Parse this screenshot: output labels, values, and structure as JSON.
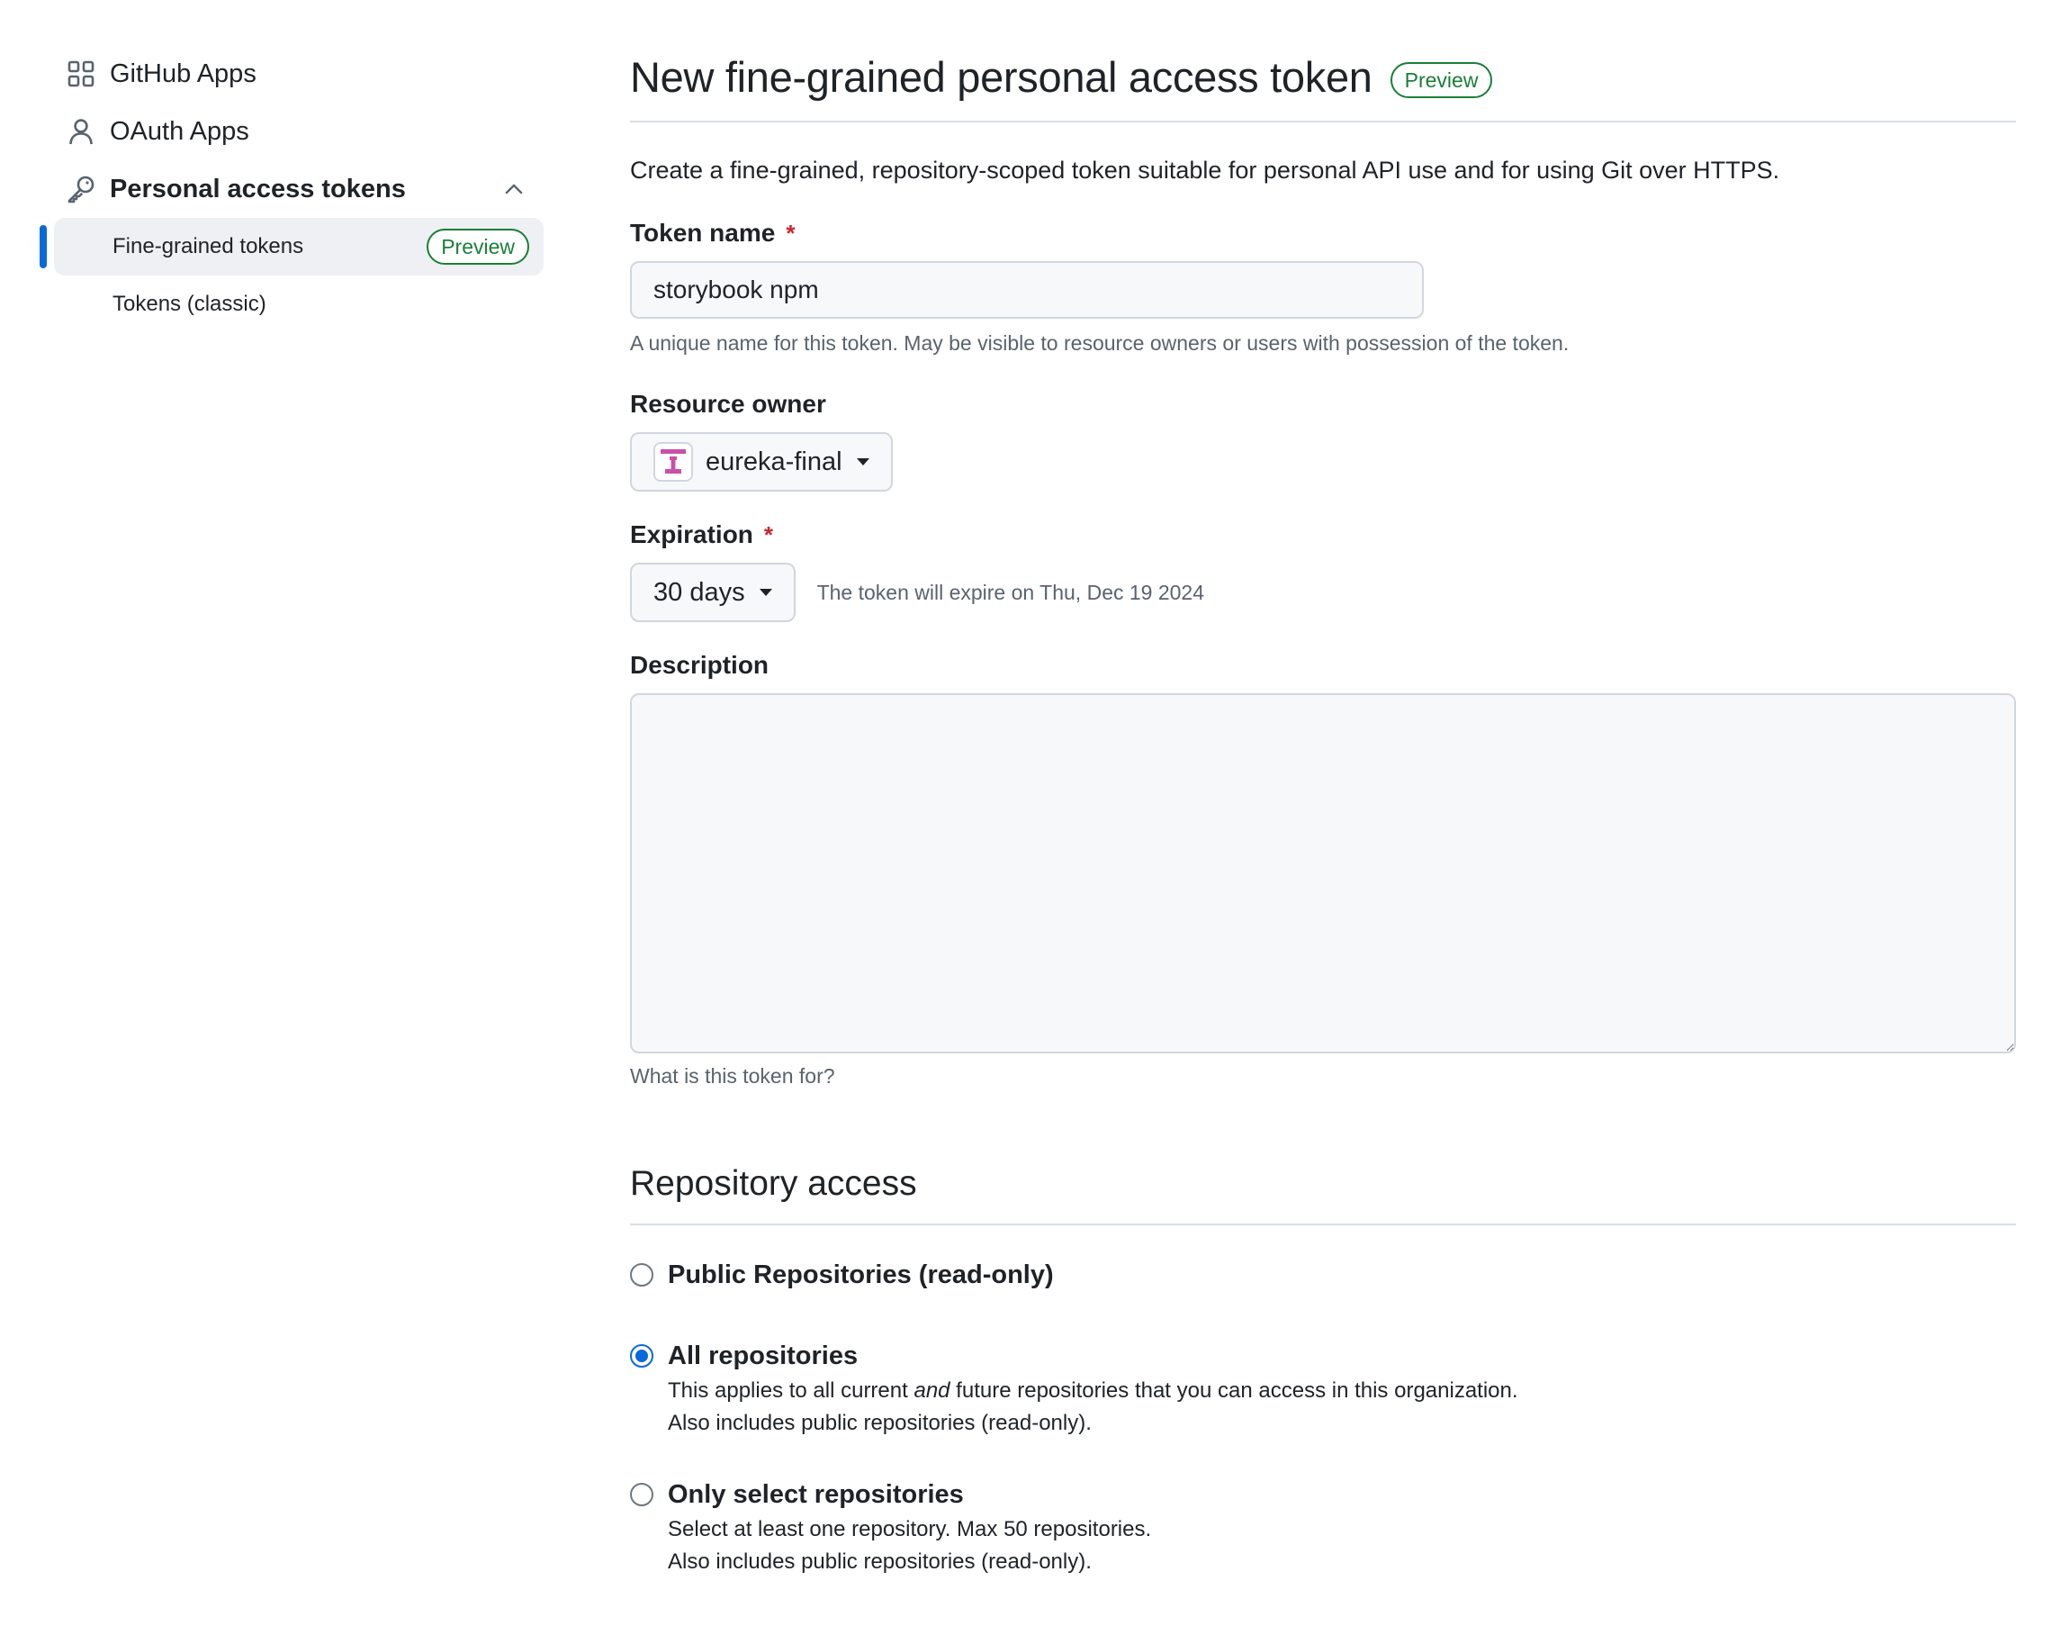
{
  "sidebar": {
    "items": [
      {
        "label": "GitHub Apps",
        "icon": "apps-icon"
      },
      {
        "label": "OAuth Apps",
        "icon": "person-icon"
      },
      {
        "label": "Personal access tokens",
        "icon": "key-icon",
        "expanded": true
      }
    ],
    "sub_items": [
      {
        "label": "Fine-grained tokens",
        "badge": "Preview",
        "active": true
      },
      {
        "label": "Tokens (classic)"
      }
    ]
  },
  "main": {
    "title": "New fine-grained personal access token",
    "title_badge": "Preview",
    "intro": "Create a fine-grained, repository-scoped token suitable for personal API use and for using Git over HTTPS.",
    "token_name": {
      "label": "Token name",
      "required_mark": "*",
      "value": "storybook npm",
      "note": "A unique name for this token. May be visible to resource owners or users with possession of the token."
    },
    "resource_owner": {
      "label": "Resource owner",
      "value": "eureka-final"
    },
    "expiration": {
      "label": "Expiration",
      "required_mark": "*",
      "value": "30 days",
      "note": "The token will expire on Thu, Dec 19 2024"
    },
    "description": {
      "label": "Description",
      "value": "",
      "note": "What is this token for?"
    },
    "repository_access": {
      "title": "Repository access",
      "options": [
        {
          "label": "Public Repositories (read-only)",
          "checked": false
        },
        {
          "label": "All repositories",
          "checked": true,
          "desc_pre": "This applies to all current ",
          "desc_em": "and",
          "desc_post": " future repositories that you can access in this organization.",
          "desc_line2": "Also includes public repositories (read-only)."
        },
        {
          "label": "Only select repositories",
          "checked": false,
          "desc_line1": "Select at least one repository. Max 50 repositories.",
          "desc_line2": "Also includes public repositories (read-only)."
        }
      ]
    }
  },
  "colors": {
    "accent": "#0969da",
    "success": "#1a7f37",
    "danger": "#cf222e",
    "muted": "#59636e",
    "org_avatar": "#c94fa8"
  }
}
